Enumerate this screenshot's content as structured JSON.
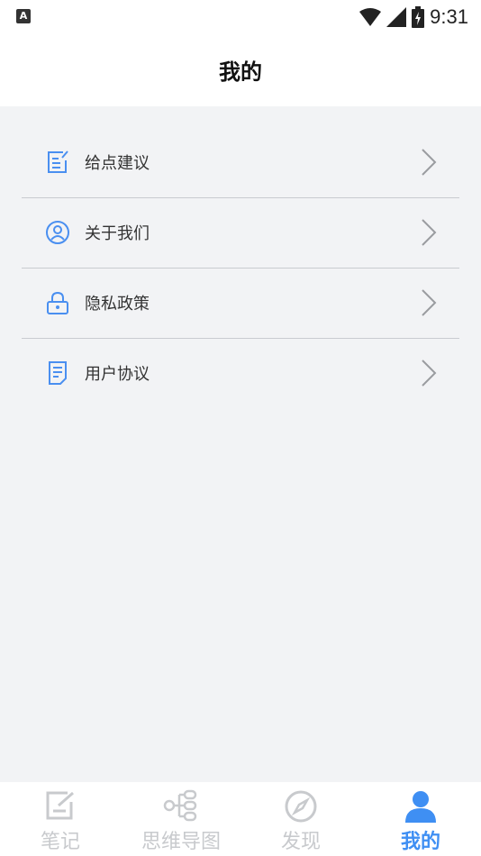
{
  "status_bar": {
    "time": "9:31",
    "left_badge": "A"
  },
  "header": {
    "title": "我的"
  },
  "menu": {
    "items": [
      {
        "label": "给点建议",
        "icon": "feedback-edit-icon"
      },
      {
        "label": "关于我们",
        "icon": "user-circle-icon"
      },
      {
        "label": "隐私政策",
        "icon": "lock-icon"
      },
      {
        "label": "用户协议",
        "icon": "document-icon"
      }
    ]
  },
  "tabbar": {
    "tabs": [
      {
        "label": "笔记",
        "icon": "note-edit-icon",
        "active": false
      },
      {
        "label": "思维导图",
        "icon": "mindmap-icon",
        "active": false
      },
      {
        "label": "发现",
        "icon": "compass-icon",
        "active": false
      },
      {
        "label": "我的",
        "icon": "user-icon",
        "active": true
      }
    ]
  },
  "colors": {
    "accent": "#3f8ff3",
    "icon_blue": "#4a8ff0",
    "inactive": "#c8cacd",
    "background": "#f2f3f5"
  }
}
